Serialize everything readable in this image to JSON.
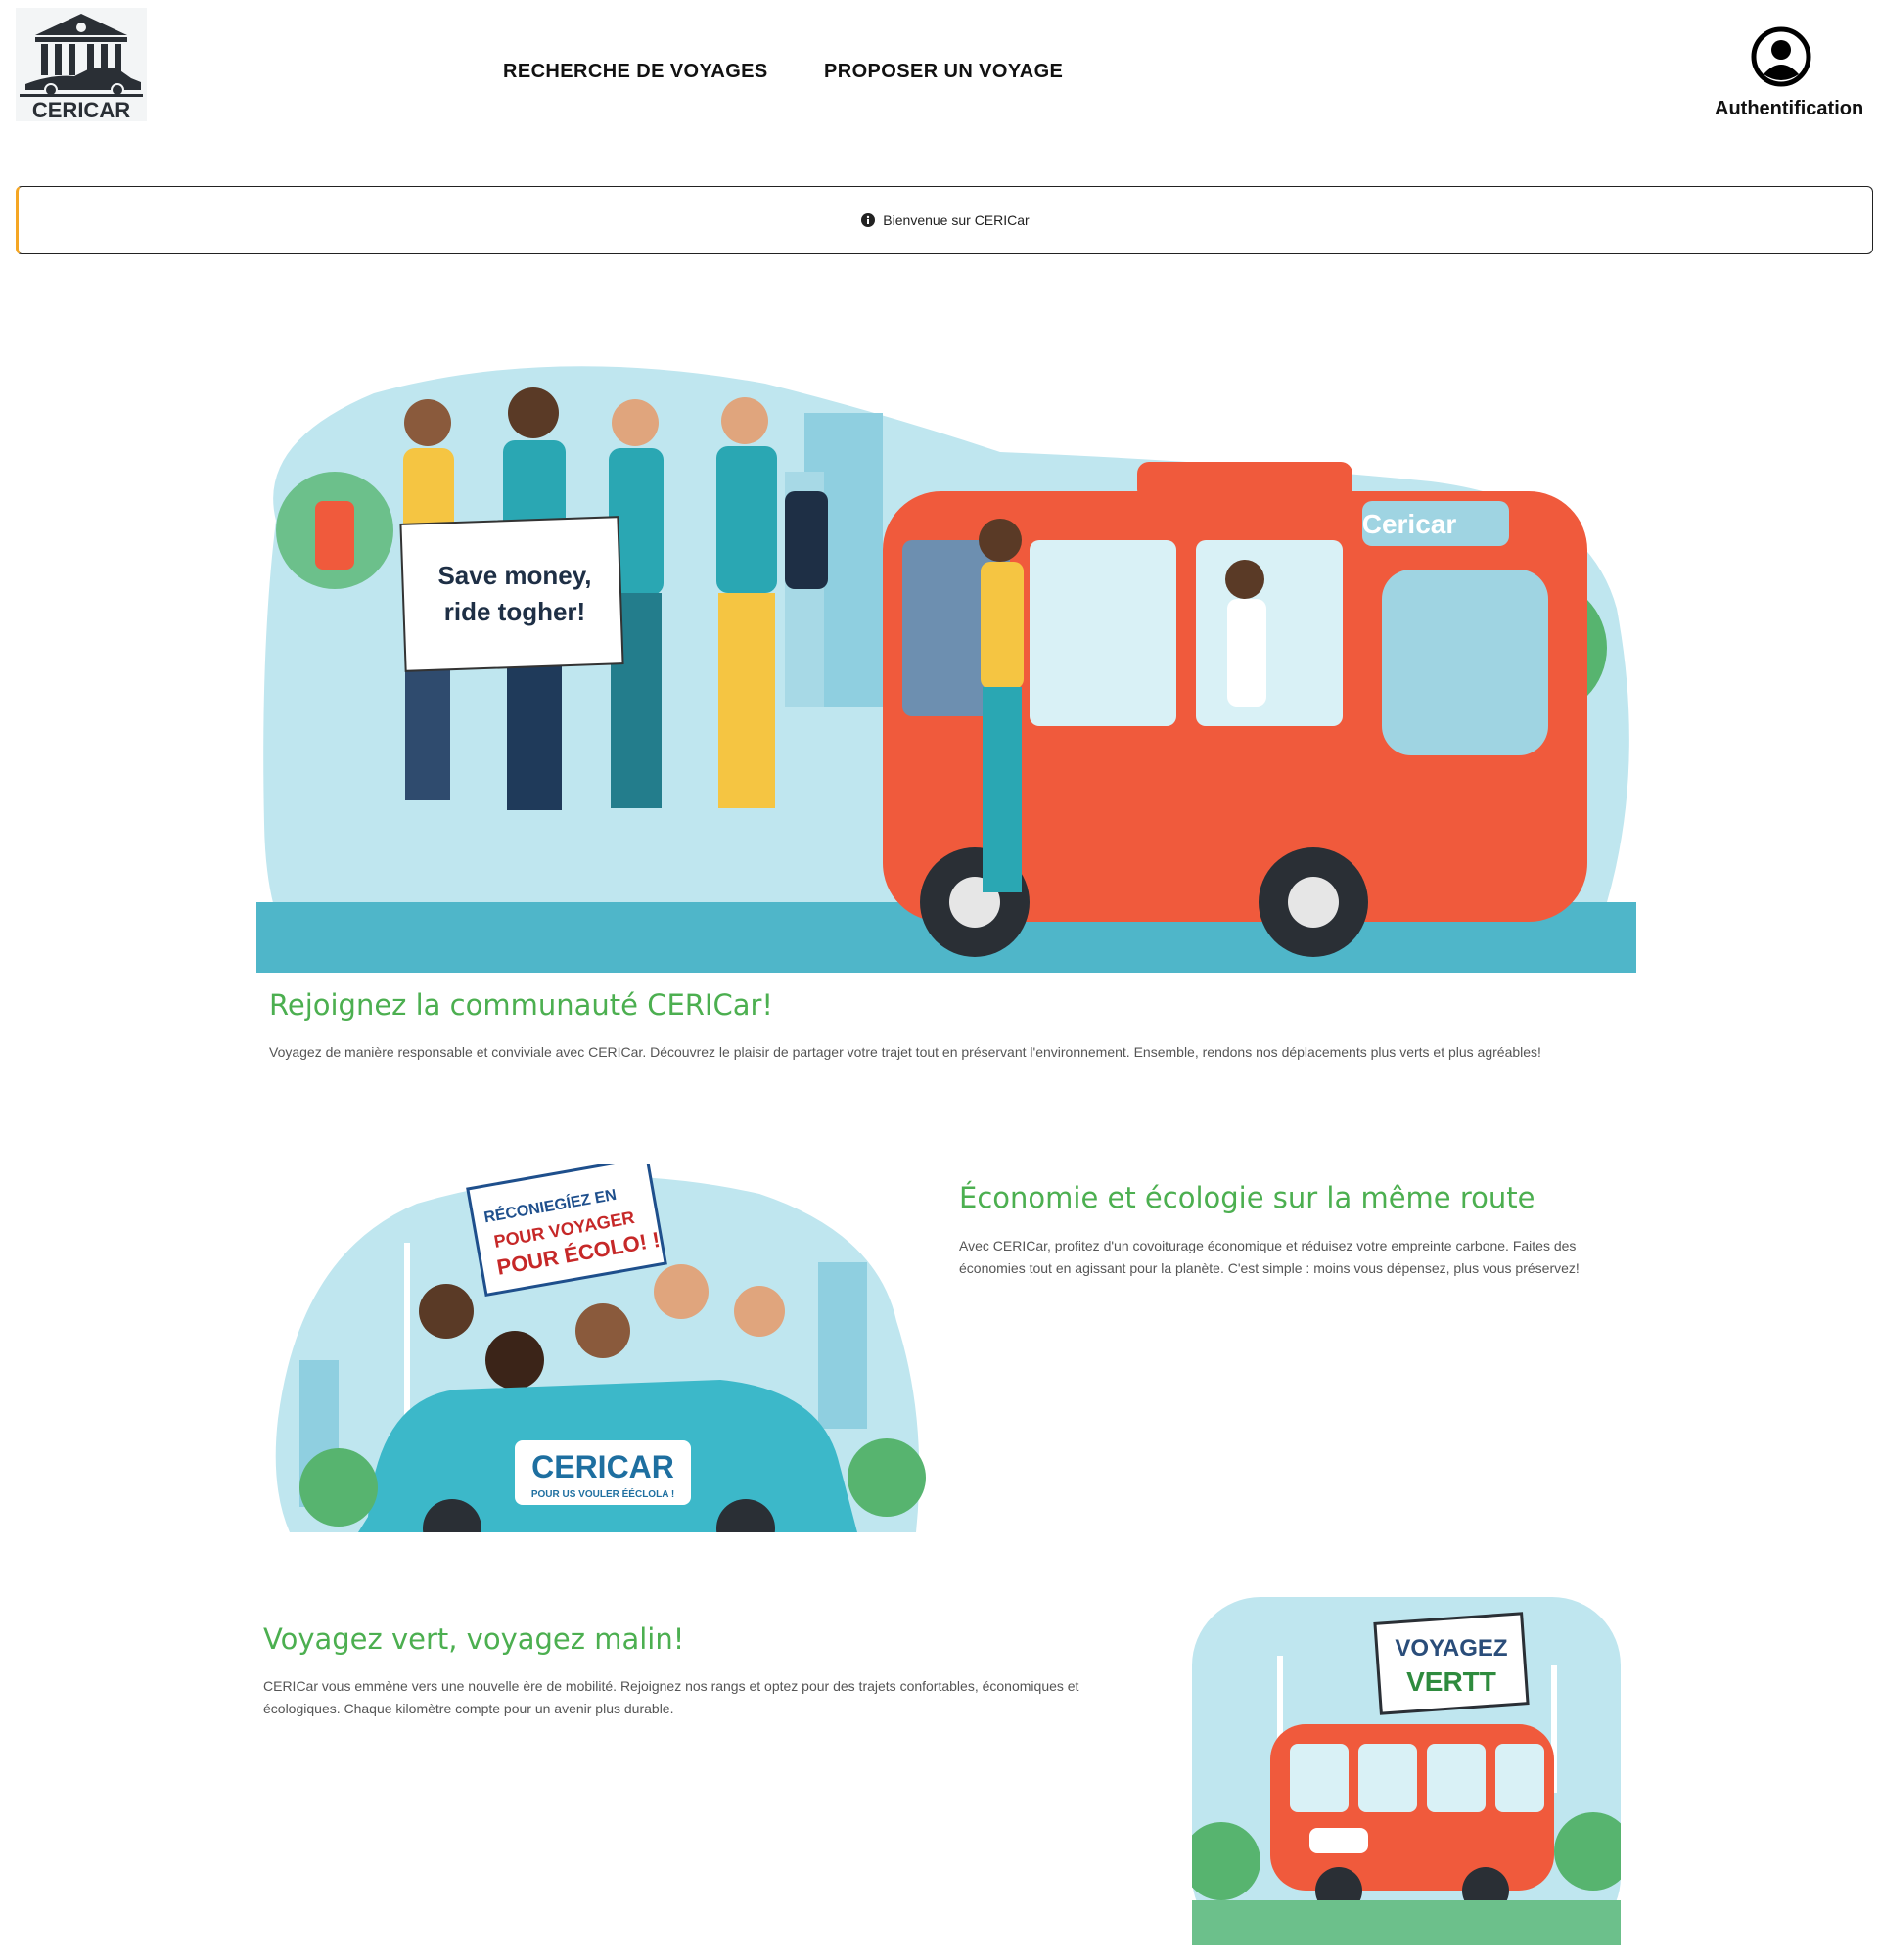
{
  "header": {
    "logo_text": "CERICAR",
    "nav": [
      {
        "label": "RECHERCHE DE VOYAGES"
      },
      {
        "label": "PROPOSER UN VOYAGE"
      }
    ],
    "auth_label": "Authentification"
  },
  "banner": {
    "icon": "info-icon",
    "text": "Bienvenue sur CERICar",
    "accent_color": "#f5a623"
  },
  "sections": {
    "community": {
      "title": "Rejoignez la communauté CERICar!",
      "text": "Voyagez de manière responsable et conviviale avec CERICar. Découvrez le plaisir de partager votre trajet tout en préservant l'environnement. Ensemble, rendons nos déplacements plus verts et plus agréables!",
      "image_sign": "Save money, ride togher!",
      "image_bus_label": "Cericar"
    },
    "eco": {
      "title": "Économie et écologie sur la même route",
      "text": "Avec CERICar, profitez d'un covoiturage économique et réduisez votre empreinte carbone. Faites des économies tout en agissant pour la planète. C'est simple : moins vous dépensez, plus vous préservez!",
      "image_sign_1": "RÉCONIEGÍEZ EN POUR VOYAGER",
      "image_sign_2": "POUR ÉCOLO! !",
      "image_car_label": "CERICAR",
      "image_car_sub": "POUR US VOULER ÉÉCLOLA !"
    },
    "vert": {
      "title": "Voyagez vert, voyagez malin!",
      "text": "CERICar vous emmène vers une nouvelle ère de mobilité. Rejoignez nos rangs et optez pour des trajets confortables, économiques et écologiques. Chaque kilomètre compte pour un avenir plus durable.",
      "image_sign": "VOYAGEZ VERTT"
    }
  },
  "colors": {
    "heading_green": "#4caf50",
    "bus_red": "#f05a3c",
    "sky_blue": "#bfe6ef"
  }
}
